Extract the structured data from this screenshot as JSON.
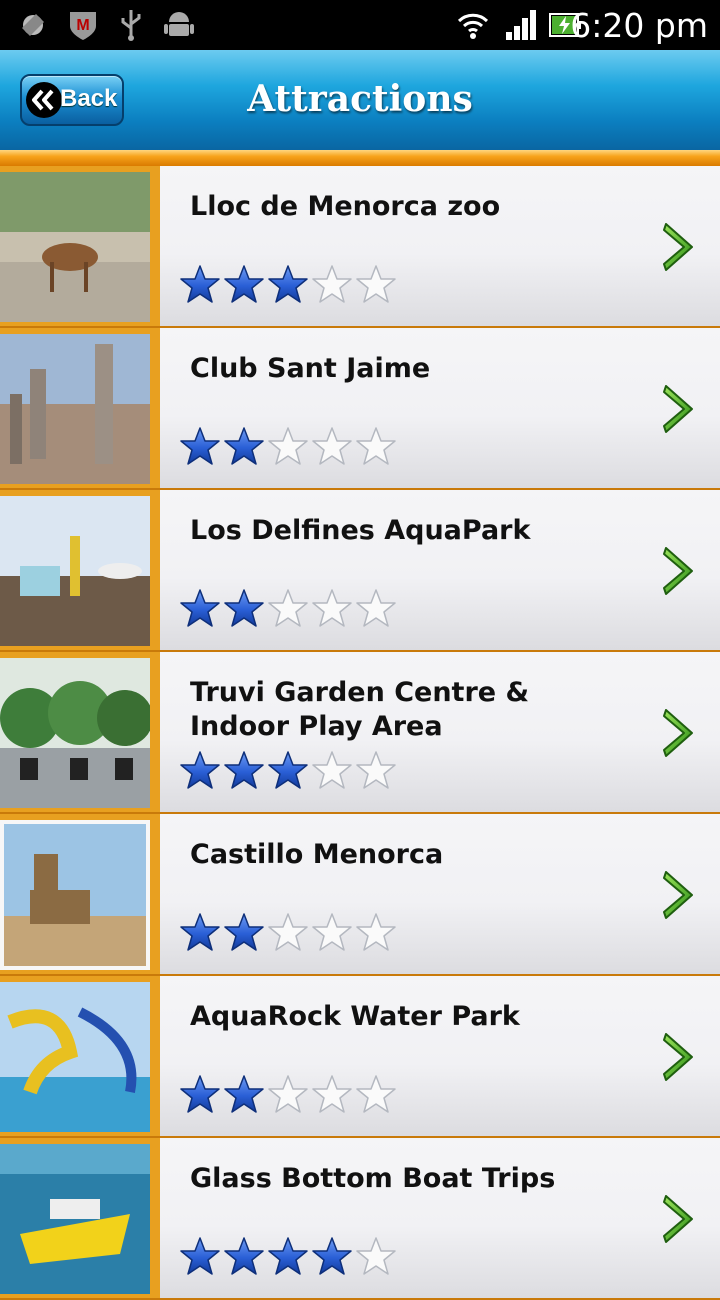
{
  "status_bar": {
    "time": "6:20 pm",
    "icons": [
      "location-icon",
      "shield-icon",
      "usb-icon",
      "android-icon",
      "wifi-icon",
      "signal-icon",
      "battery-icon"
    ]
  },
  "header": {
    "back_label": "Back",
    "title": "Attractions"
  },
  "colors": {
    "header_blue": "#1ea6de",
    "accent_orange": "#f7a21a",
    "star_blue": "#2a5fd6",
    "chevron_green": "#3db02a"
  },
  "attractions": [
    {
      "name": "Lloc de Menorca zoo",
      "rating": 3
    },
    {
      "name": "Club Sant Jaime",
      "rating": 2
    },
    {
      "name": "Los Delfines AquaPark",
      "rating": 2
    },
    {
      "name": "Truvi Garden Centre & Indoor Play Area",
      "rating": 3
    },
    {
      "name": "Castillo Menorca",
      "rating": 2
    },
    {
      "name": "AquaRock Water Park",
      "rating": 2
    },
    {
      "name": "Glass Bottom Boat Trips",
      "rating": 4
    }
  ],
  "rating_max": 5
}
